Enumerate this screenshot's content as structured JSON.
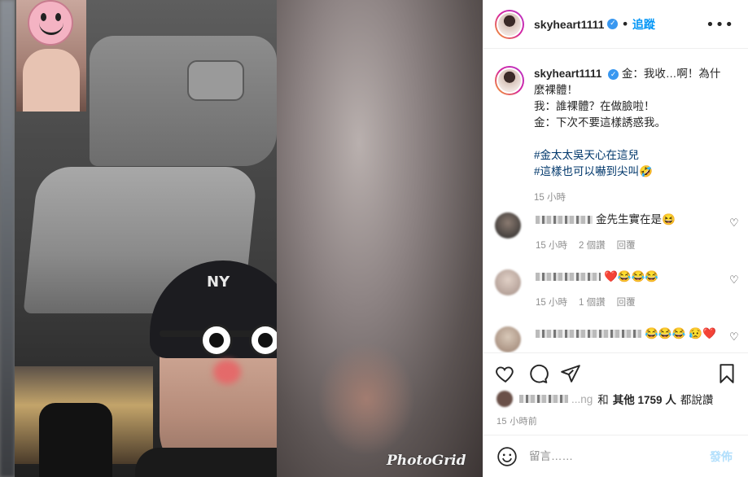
{
  "media": {
    "watermark": "PhotoGrid",
    "cap_logo": "NY"
  },
  "header": {
    "username": "skyheart1111",
    "verified_mark": "✓",
    "separator": "•",
    "follow_label": "追蹤",
    "more_label": "•••"
  },
  "caption": {
    "username": "skyheart1111",
    "lines": [
      "金：我收…啊！為什麼裸體！",
      "我：誰裸體？在做臉啦！",
      "金：下次不要這樣誘惑我。"
    ],
    "hashtags": [
      "#金太太吳天心在這兒",
      "#這樣也可以嚇到尖叫🤣"
    ],
    "time": "15 小時"
  },
  "comments": [
    {
      "text": "金先生實在是😆",
      "time": "15 小時",
      "likes": "2 個讚",
      "reply": "回覆"
    },
    {
      "text": "❤️😂😂😂",
      "time": "15 小時",
      "likes": "1 個讚",
      "reply": "回覆"
    },
    {
      "text": "😂😂😂 😥❤️",
      "time": "",
      "likes": "",
      "reply": ""
    }
  ],
  "likes": {
    "prefix": "和",
    "others": "其他 1759 人",
    "suffix": "都說讚",
    "blur_name": "...ng"
  },
  "post_time": "15 小時前",
  "add_comment": {
    "placeholder": "留言……",
    "post_label": "發佈"
  },
  "colors": {
    "accent": "#0095f6",
    "verified": "#3897f0",
    "hashtag": "#00376b",
    "muted": "#8e8e8e"
  }
}
